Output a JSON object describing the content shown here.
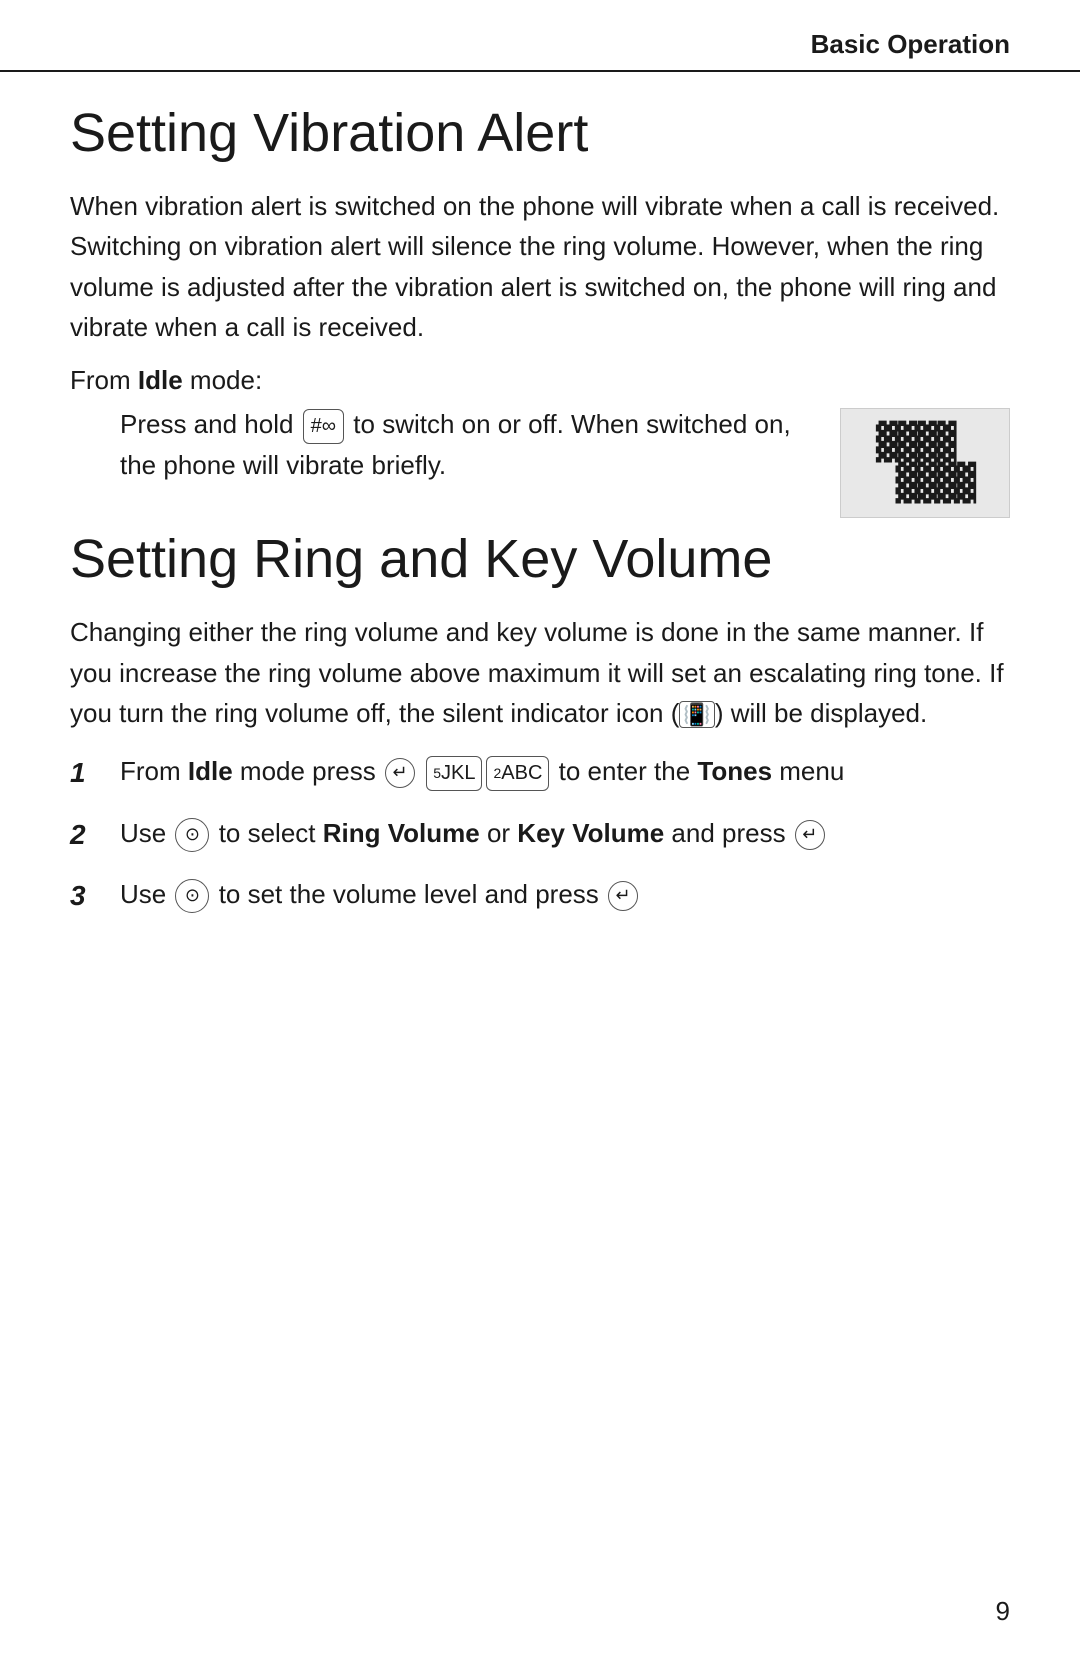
{
  "header": {
    "title": "Basic Operation"
  },
  "section1": {
    "title": "Setting Vibration Alert",
    "intro": "When vibration alert is switched on the phone will vibrate when a call is received. Switching on vibration alert will silence the ring volume. However, when the ring volume is adjusted after the vibration alert is switched on, the phone will ring and vibrate when a call is received.",
    "from_mode_label": "From ",
    "from_mode_word": "Idle",
    "from_mode_suffix": " mode:",
    "instruction": "Press and hold   to switch on or off. When switched on, the phone will vibrate briefly."
  },
  "section2": {
    "title": "Setting Ring and Key Volume",
    "intro": "Changing either the ring volume and key volume is done in the same manner. If you increase the ring volume above maximum it will set an escalating ring tone. If you turn the ring volume off, the silent indicator icon ( 🔇 ) will be displayed.",
    "steps": [
      {
        "number": "1",
        "text_parts": [
          "From ",
          "Idle",
          " mode press     to enter the ",
          "Tones",
          " menu"
        ]
      },
      {
        "number": "2",
        "text_parts": [
          "Use   to select ",
          "Ring Volume",
          " or ",
          "Key Volume",
          " and press  "
        ]
      },
      {
        "number": "3",
        "text_parts": [
          "Use   to set the volume level and press  "
        ]
      }
    ]
  },
  "page_number": "9"
}
